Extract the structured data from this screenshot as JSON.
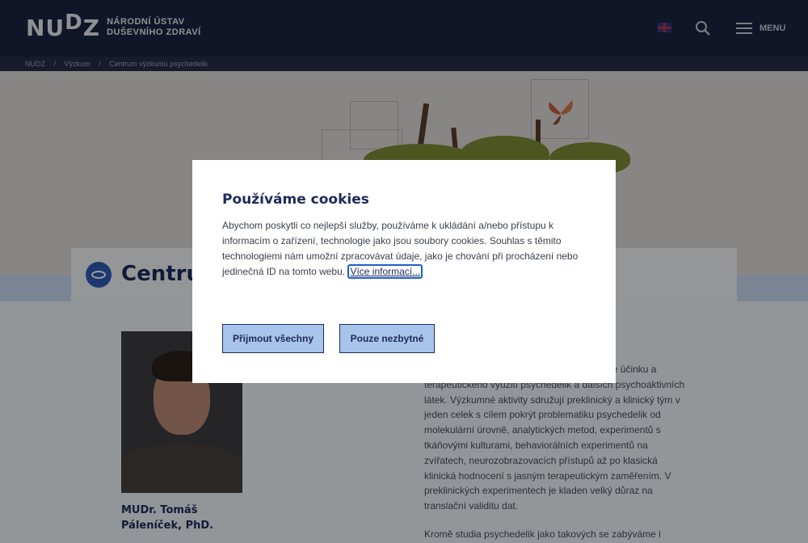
{
  "header": {
    "logo_mark": "NUDZ",
    "logo_line1": "NÁRODNÍ ÚSTAV",
    "logo_line2": "DUŠEVNÍHO ZDRAVÍ",
    "menu_label": "MENU"
  },
  "breadcrumb": {
    "items": [
      "NUDZ",
      "/",
      "Výzkum",
      "/",
      "Centrum výzkumu psychedelik"
    ]
  },
  "title_card": {
    "title": "Centrum"
  },
  "person": {
    "name": "MUDr. Tomáš Páleníček, PhD."
  },
  "article": {
    "p1": "Centrum se zabývá výzkumem neurobiologie účinku a terapeutického využití psychedelik a dalších psychoaktivních látek. Výzkumné aktivity sdružují preklinický a klinický tým v jeden celek s cílem pokrýt problematiku psychedelik od molekulární úrovně, analytických metod, experimentů s tkáňovými kulturami, behaviorálních experimentů na zvířatech, neurozobrazovacích přístupů až po klasická klinická hodnocení s jasným terapeutickým zaměřením. V preklinických experimentech je kladen velký důraz na translační validitu dat.",
    "p2": "Kromě studia psychedelik jako takových se zabýváme i"
  },
  "cookie_modal": {
    "title": "Používáme cookies",
    "body": "Abychom poskytli co nejlepší služby, používáme k ukládání a/nebo přístupu k informacím o zařízení, technologie jako jsou soubory cookies. Souhlas s těmito technologiemi nám umožní zpracovávat údaje, jako je chování při procházení nebo jedinečná ID na tomto webu.",
    "more_link": "Více informací...",
    "accept_all": "Přijmout všechny",
    "necessary_only": "Pouze nezbytné"
  },
  "colors": {
    "header_bg": "#1b2340",
    "accent_blue": "#2f5bb7",
    "button_bg": "#a9c4ea",
    "title_color": "#1d2a5a"
  }
}
